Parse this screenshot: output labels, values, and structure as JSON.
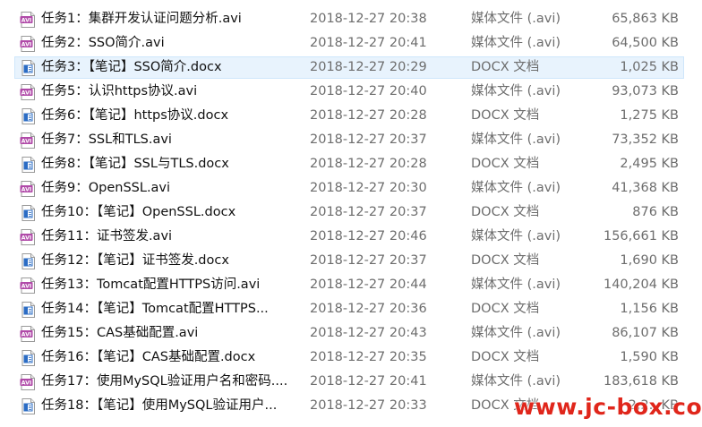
{
  "files": [
    {
      "name": "任务1：集群开发认证问题分析.avi",
      "date": "2018-12-27 20:38",
      "type": "媒体文件 (.avi)",
      "size": "65,863 KB",
      "icon": "avi-file-icon"
    },
    {
      "name": "任务2：SSO简介.avi",
      "date": "2018-12-27 20:41",
      "type": "媒体文件 (.avi)",
      "size": "64,500 KB",
      "icon": "avi-file-icon"
    },
    {
      "name": "任务3：【笔记】SSO简介.docx",
      "date": "2018-12-27 20:29",
      "type": "DOCX 文档",
      "size": "1,025 KB",
      "icon": "docx-file-icon",
      "selected": true
    },
    {
      "name": "任务5：认识https协议.avi",
      "date": "2018-12-27 20:40",
      "type": "媒体文件 (.avi)",
      "size": "93,073 KB",
      "icon": "avi-file-icon"
    },
    {
      "name": "任务6：【笔记】https协议.docx",
      "date": "2018-12-27 20:28",
      "type": "DOCX 文档",
      "size": "1,275 KB",
      "icon": "docx-file-icon"
    },
    {
      "name": "任务7：SSL和TLS.avi",
      "date": "2018-12-27 20:37",
      "type": "媒体文件 (.avi)",
      "size": "73,352 KB",
      "icon": "avi-file-icon"
    },
    {
      "name": "任务8：【笔记】SSL与TLS.docx",
      "date": "2018-12-27 20:28",
      "type": "DOCX 文档",
      "size": "2,495 KB",
      "icon": "docx-file-icon"
    },
    {
      "name": "任务9：OpenSSL.avi",
      "date": "2018-12-27 20:30",
      "type": "媒体文件 (.avi)",
      "size": "41,368 KB",
      "icon": "avi-file-icon"
    },
    {
      "name": "任务10：【笔记】OpenSSL.docx",
      "date": "2018-12-27 20:37",
      "type": "DOCX 文档",
      "size": "876 KB",
      "icon": "docx-file-icon"
    },
    {
      "name": "任务11：证书签发.avi",
      "date": "2018-12-27 20:46",
      "type": "媒体文件 (.avi)",
      "size": "156,661 KB",
      "icon": "avi-file-icon"
    },
    {
      "name": "任务12：【笔记】证书签发.docx",
      "date": "2018-12-27 20:37",
      "type": "DOCX 文档",
      "size": "1,690 KB",
      "icon": "docx-file-icon"
    },
    {
      "name": "任务13：Tomcat配置HTTPS访问.avi",
      "date": "2018-12-27 20:44",
      "type": "媒体文件 (.avi)",
      "size": "140,204 KB",
      "icon": "avi-file-icon"
    },
    {
      "name": "任务14：【笔记】Tomcat配置HTTPS...",
      "date": "2018-12-27 20:36",
      "type": "DOCX 文档",
      "size": "1,156 KB",
      "icon": "docx-file-icon"
    },
    {
      "name": "任务15：CAS基础配置.avi",
      "date": "2018-12-27 20:43",
      "type": "媒体文件 (.avi)",
      "size": "86,107 KB",
      "icon": "avi-file-icon"
    },
    {
      "name": "任务16：【笔记】CAS基础配置.docx",
      "date": "2018-12-27 20:35",
      "type": "DOCX 文档",
      "size": "1,590 KB",
      "icon": "docx-file-icon"
    },
    {
      "name": "任务17：使用MySQL验证用户名和密码....",
      "date": "2018-12-27 20:41",
      "type": "媒体文件 (.avi)",
      "size": "183,618 KB",
      "icon": "avi-file-icon"
    },
    {
      "name": "任务18：【笔记】使用MySQL验证用户...",
      "date": "2018-12-27 20:33",
      "type": "DOCX 文档",
      "size": "2,2.. KB",
      "icon": "docx-file-icon"
    }
  ],
  "watermark": "www.jc-box.com",
  "colors": {
    "avi_icon": "#b04aa8",
    "docx_icon": "#2b6cc4",
    "selection": "#e8f3fd",
    "watermark": "#e0261b"
  }
}
